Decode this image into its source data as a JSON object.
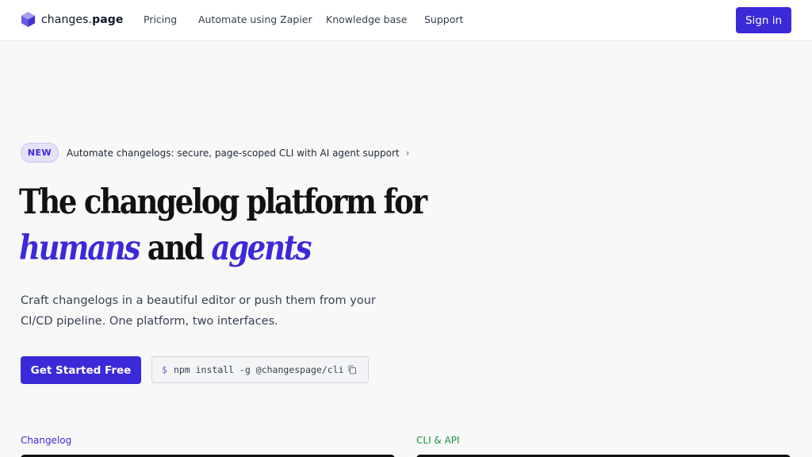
{
  "nav": {
    "brand_prefix": "changes.",
    "brand_suffix": "page",
    "links": [
      "Pricing",
      "Automate using Zapier",
      "Knowledge base",
      "Support"
    ],
    "signin": "Sign in"
  },
  "announcement": {
    "badge": "NEW",
    "text": "Automate changelogs: secure, page-scoped CLI with AI agent support",
    "chevron": "›"
  },
  "hero": {
    "line1": "The changelog platform for",
    "line2_word1": "humans",
    "line2_word2": "and",
    "line2_word3": "agents",
    "subtitle": "Craft changelogs in a beautiful editor or push them from your CI/CD pipeline. One platform, two interfaces.",
    "cta": "Get Started Free",
    "command_prompt": "$",
    "command": "npm install -g @changespage/cli"
  },
  "sections": {
    "left_label": "Changelog",
    "right_label": "CLI & API"
  },
  "colors": {
    "brand": "#3b2ad8",
    "cli_label": "#1f8f4a"
  },
  "icons": [
    "cube-logo-icon",
    "chevron-right-icon",
    "copy-icon"
  ]
}
